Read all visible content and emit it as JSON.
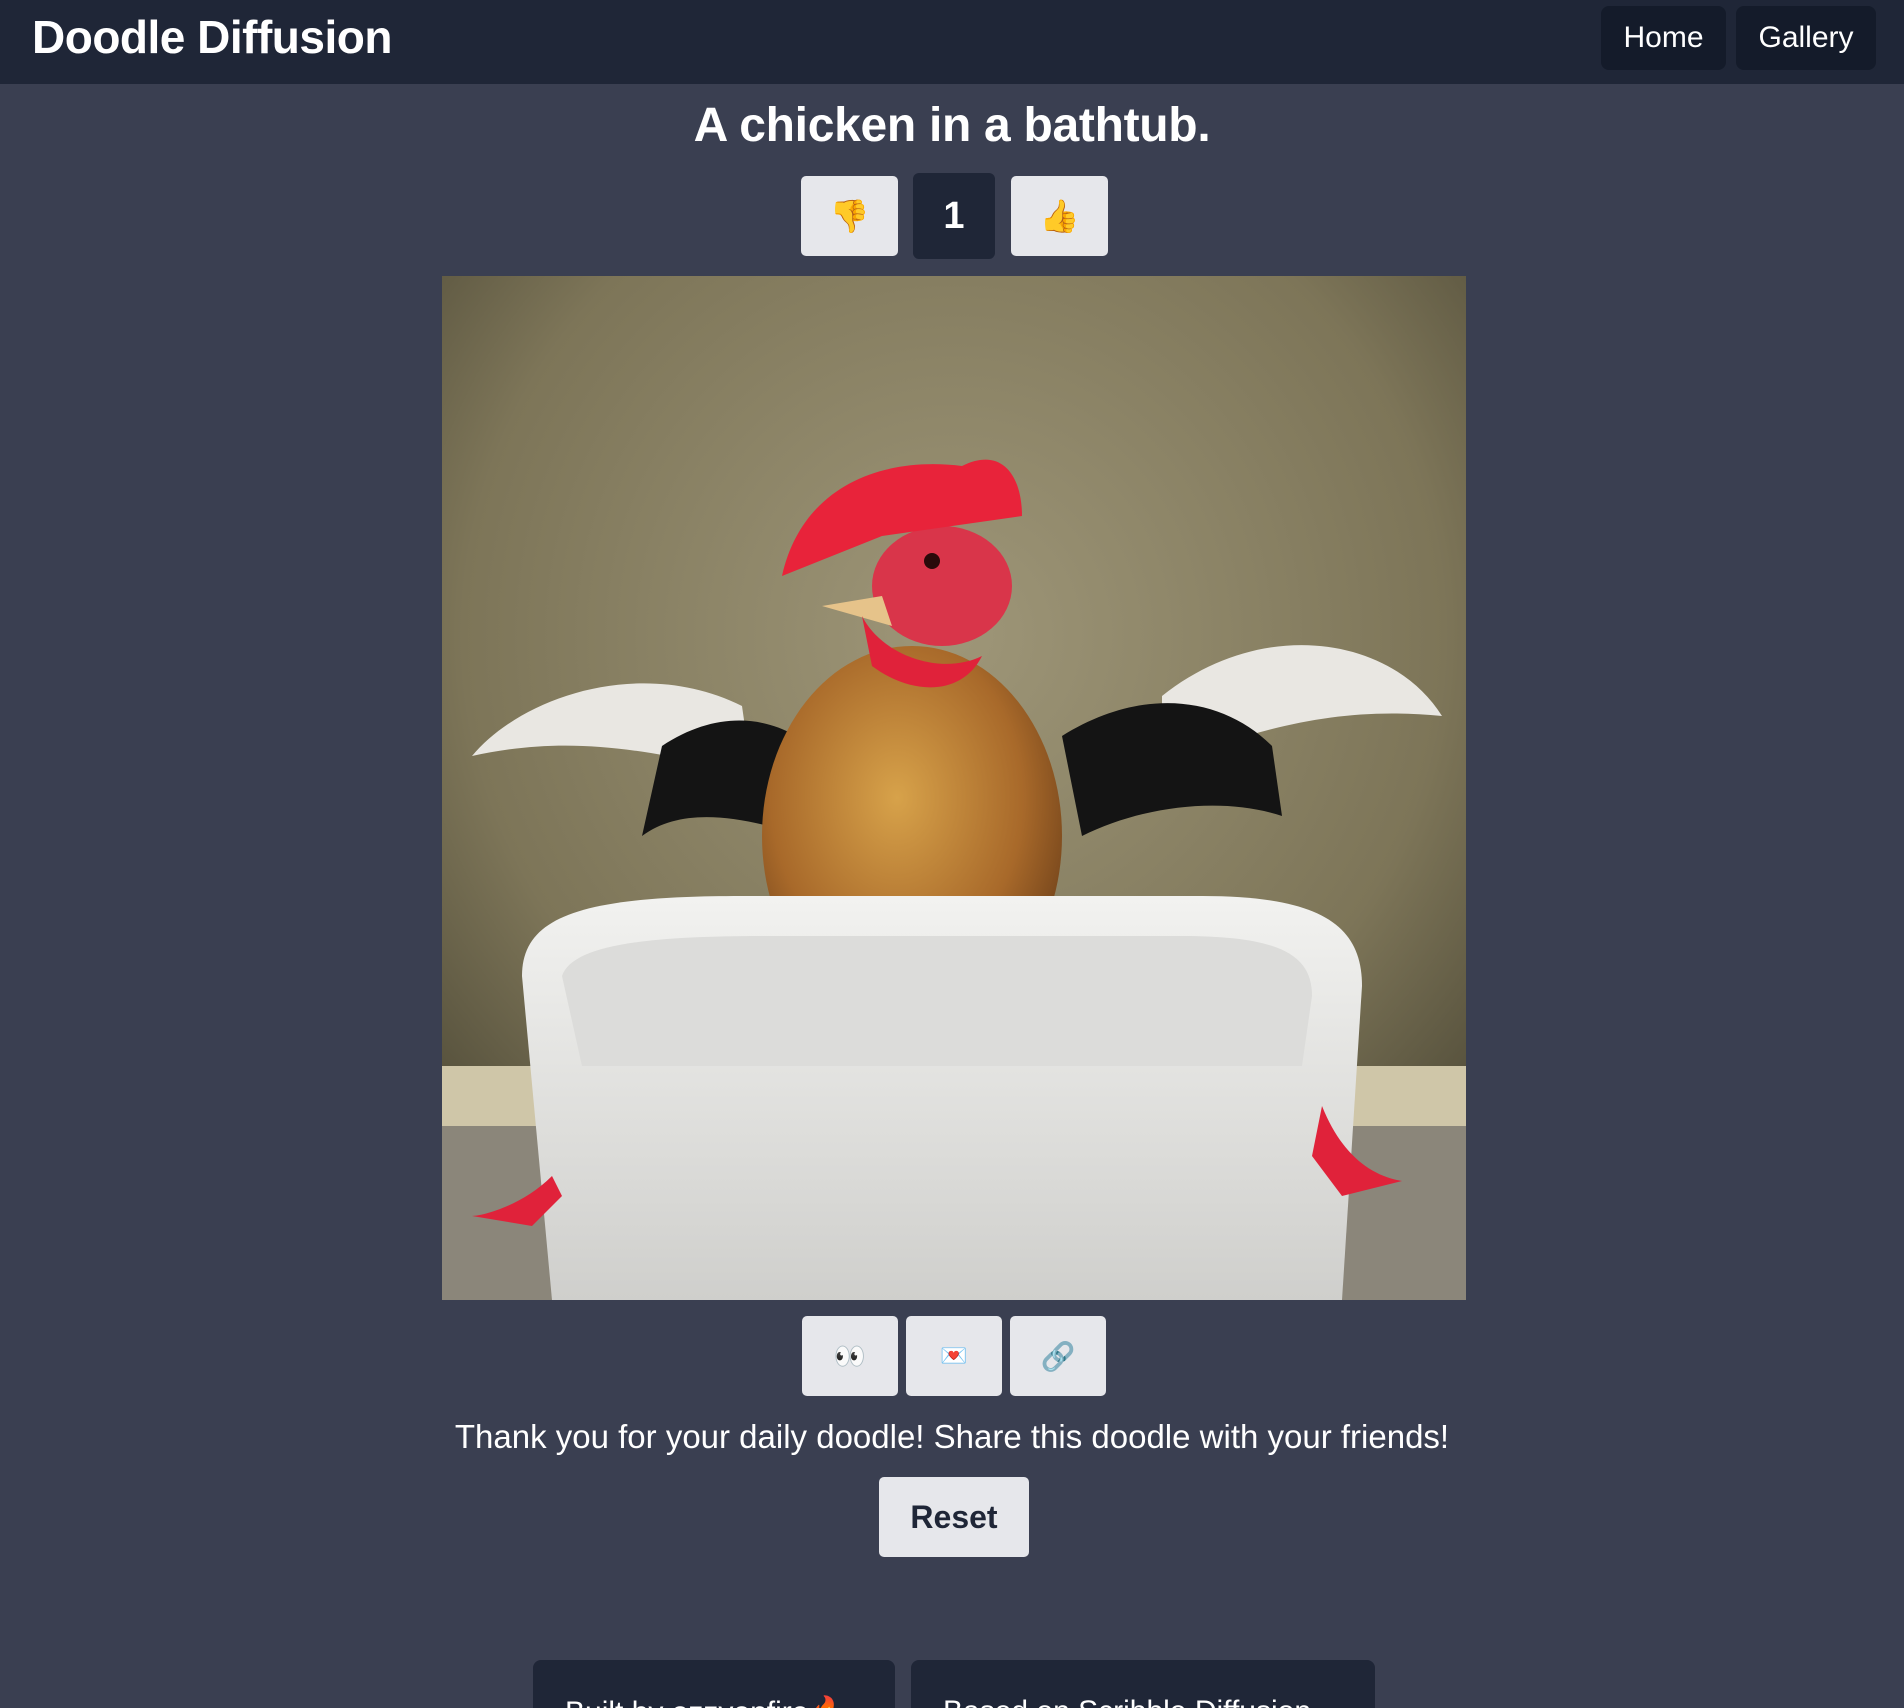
{
  "nav": {
    "brand": "Doodle Diffusion",
    "home_label": "Home",
    "gallery_label": "Gallery"
  },
  "doodle": {
    "prompt": "A chicken in a bathtub.",
    "vote_score": "1",
    "downvote_icon": "👎",
    "upvote_icon": "👍",
    "image_alt": "AI generated image of a rooster standing in a white bathtub"
  },
  "actions": {
    "view_icon": "👀",
    "mail_icon": "💌",
    "link_icon": "🔗"
  },
  "message": "Thank you for your daily doodle! Share this doodle with your friends!",
  "reset_label": "Reset",
  "footer": {
    "built_by": "Built by ozzyonfire🔥",
    "based_on": "Based on Scribble Diffusion"
  }
}
